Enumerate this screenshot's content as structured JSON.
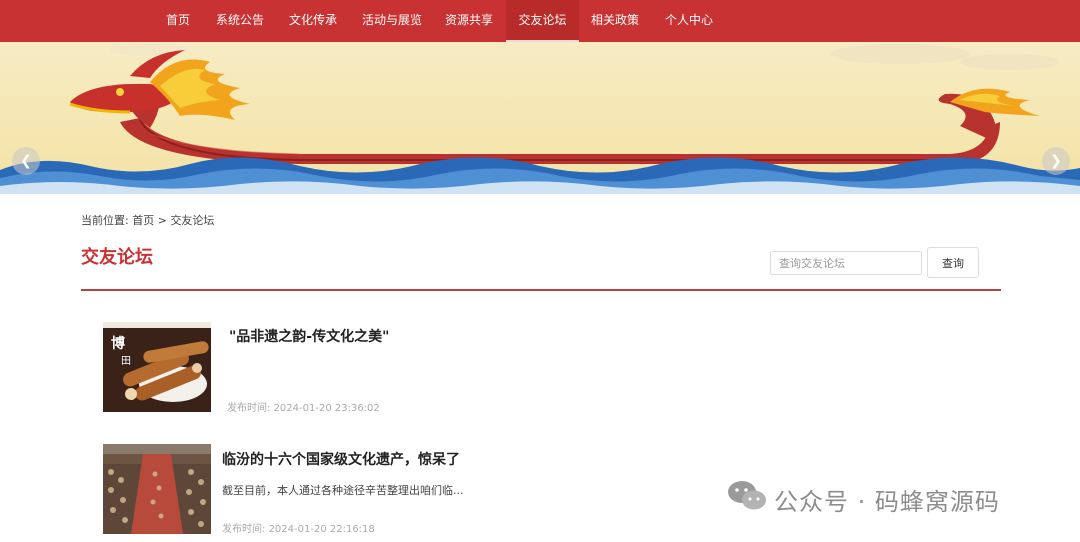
{
  "nav": {
    "items": [
      {
        "label": "首页"
      },
      {
        "label": "系统公告"
      },
      {
        "label": "文化传承"
      },
      {
        "label": "活动与展览"
      },
      {
        "label": "资源共享"
      },
      {
        "label": "交友论坛",
        "active": true
      },
      {
        "label": "相关政策"
      },
      {
        "label": "个人中心"
      }
    ]
  },
  "banner": {
    "prev_icon": "chevron-left-icon",
    "next_icon": "chevron-right-icon"
  },
  "breadcrumb": {
    "prefix": "当前位置:",
    "home": "首页",
    "separator": ">",
    "current": "交友论坛"
  },
  "page": {
    "title": "交友论坛",
    "accent_color": "#c93232"
  },
  "search": {
    "placeholder": "查询交友论坛",
    "button_label": "查询"
  },
  "posts": [
    {
      "title": "\"品非遗之韵-传文化之美\"",
      "excerpt": "",
      "time_label": "发布时间:",
      "time": "2024-01-20 23:36:02"
    },
    {
      "title": "临汾的十六个国家级文化遗产，惊呆了",
      "excerpt": "截至目前，本人通过各种途径辛苦整理出咱们临...",
      "time_label": "发布时间:",
      "time": "2024-01-20 22:16:18"
    }
  ],
  "watermark": {
    "text": "公众号 · 码蜂窝源码",
    "icon": "wechat-icon"
  }
}
